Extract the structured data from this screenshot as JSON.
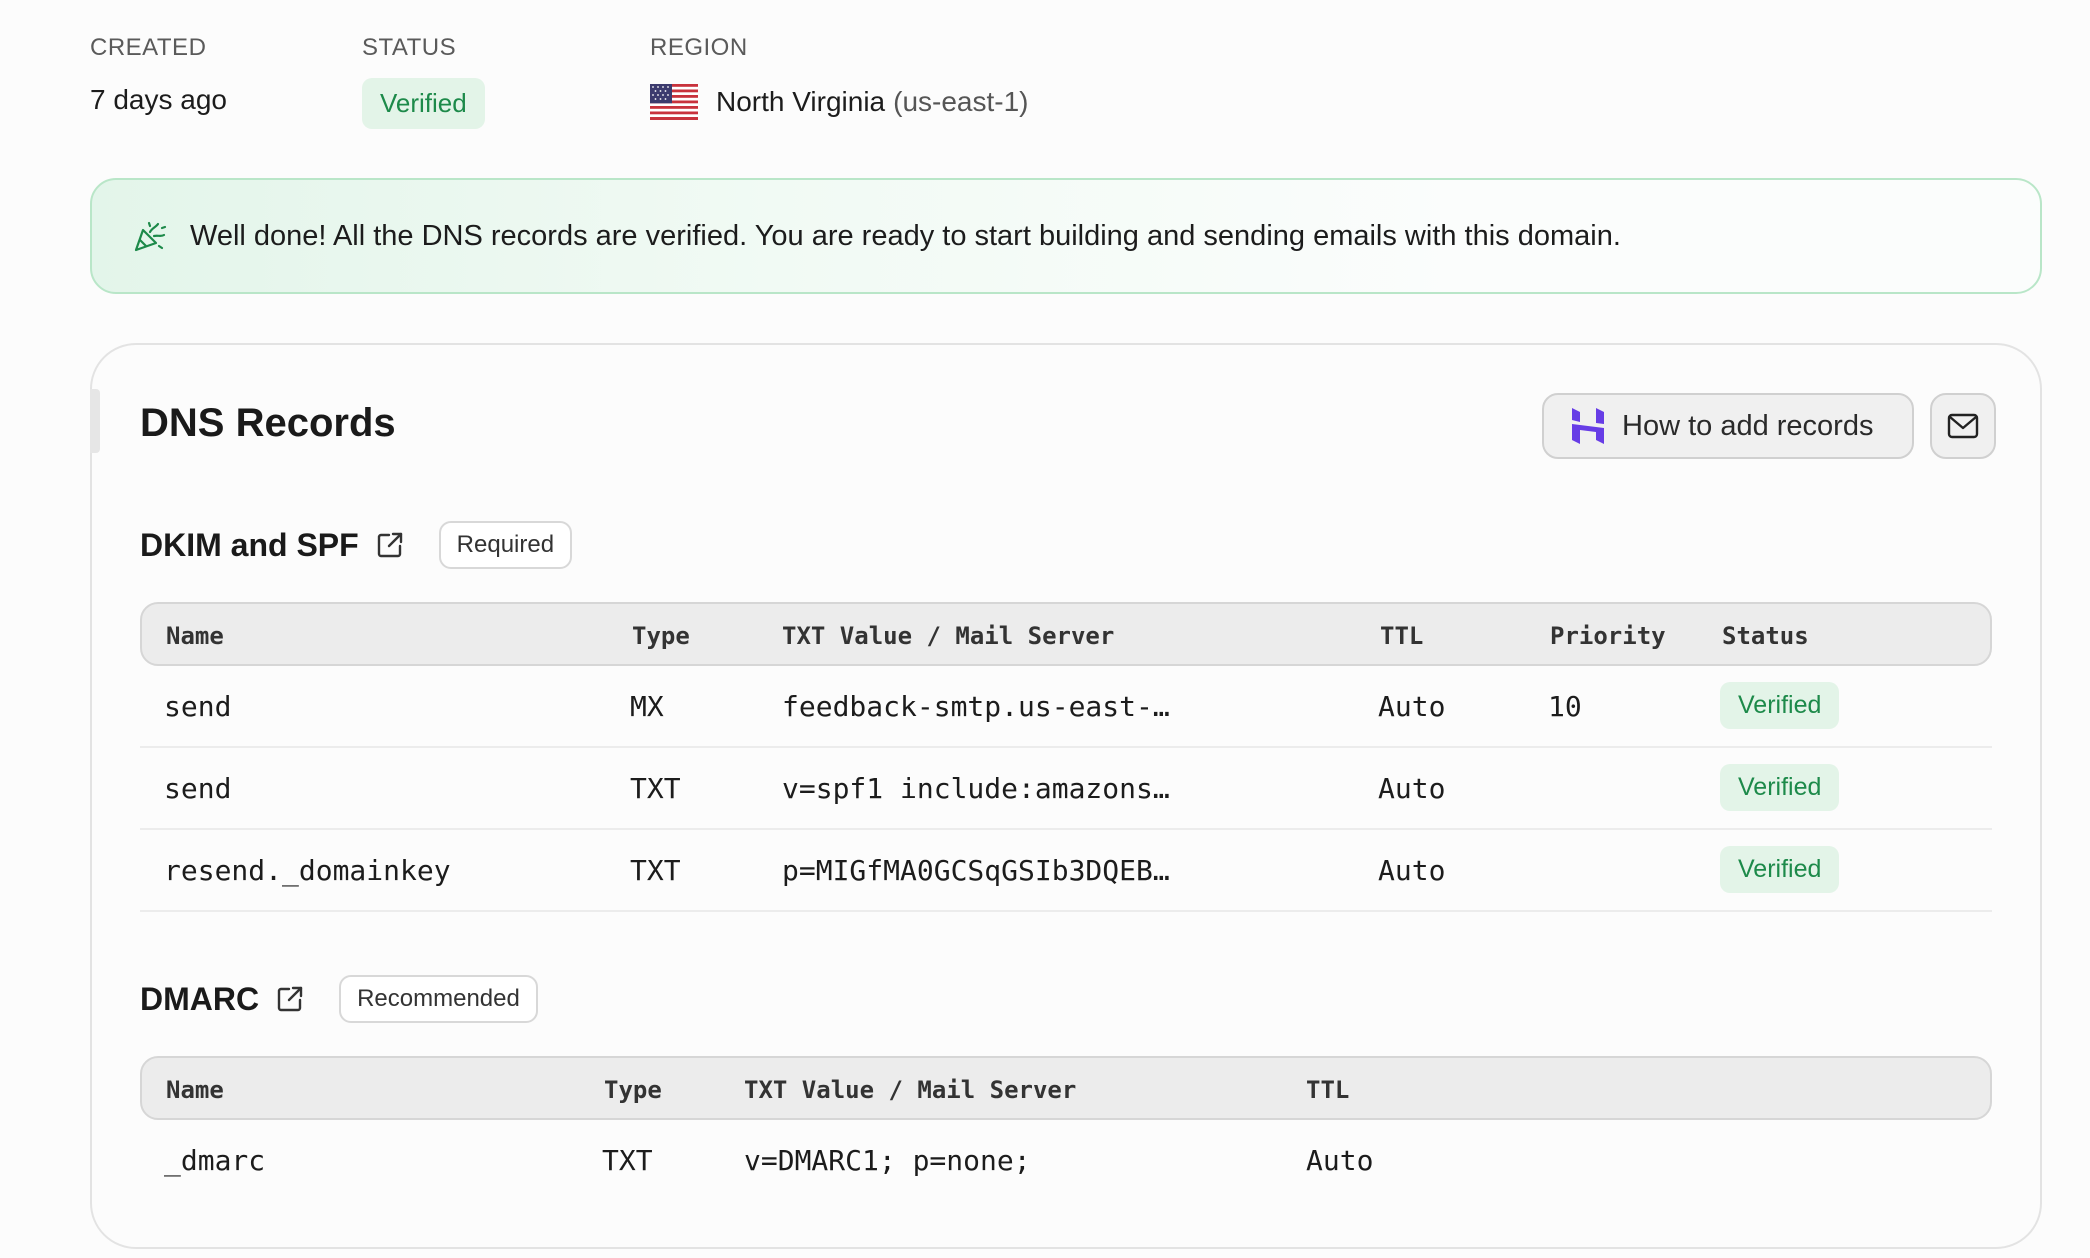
{
  "meta": {
    "created_label": "CREATED",
    "created_value": "7 days ago",
    "status_label": "STATUS",
    "status_value": "Verified",
    "region_label": "REGION",
    "region_name": "North Virginia",
    "region_code": "(us-east-1)",
    "region_flag": "us-flag-icon"
  },
  "banner": {
    "icon": "party-popper-icon",
    "text": "Well done! All the DNS records are verified. You are ready to start building and sending emails with this domain."
  },
  "dns": {
    "title": "DNS Records",
    "howto_label": "How to add records",
    "howto_icon": "hostinger-logo-icon",
    "mail_icon": "mail-icon",
    "dkim": {
      "title": "DKIM and SPF",
      "tag": "Required",
      "columns": [
        "Name",
        "Type",
        "TXT Value / Mail Server",
        "TTL",
        "Priority",
        "Status"
      ],
      "rows": [
        {
          "name": "send",
          "type": "MX",
          "value": "feedback-smtp.us-east-…",
          "ttl": "Auto",
          "priority": "10",
          "status": "Verified"
        },
        {
          "name": "send",
          "type": "TXT",
          "value": "v=spf1 include:amazons…",
          "ttl": "Auto",
          "priority": "",
          "status": "Verified"
        },
        {
          "name": "resend._domainkey",
          "type": "TXT",
          "value": "p=MIGfMA0GCSqGSIb3DQEB…",
          "ttl": "Auto",
          "priority": "",
          "status": "Verified"
        }
      ]
    },
    "dmarc": {
      "title": "DMARC",
      "tag": "Recommended",
      "columns": [
        "Name",
        "Type",
        "TXT Value / Mail Server",
        "TTL"
      ],
      "rows": [
        {
          "name": "_dmarc",
          "type": "TXT",
          "value": "v=DMARC1; p=none;",
          "ttl": "Auto"
        }
      ]
    }
  },
  "colors": {
    "verified_bg": "#e3f4e8",
    "verified_text": "#1d8a4a",
    "banner_border": "#b9e6c8",
    "hostinger_purple": "#673de6"
  }
}
